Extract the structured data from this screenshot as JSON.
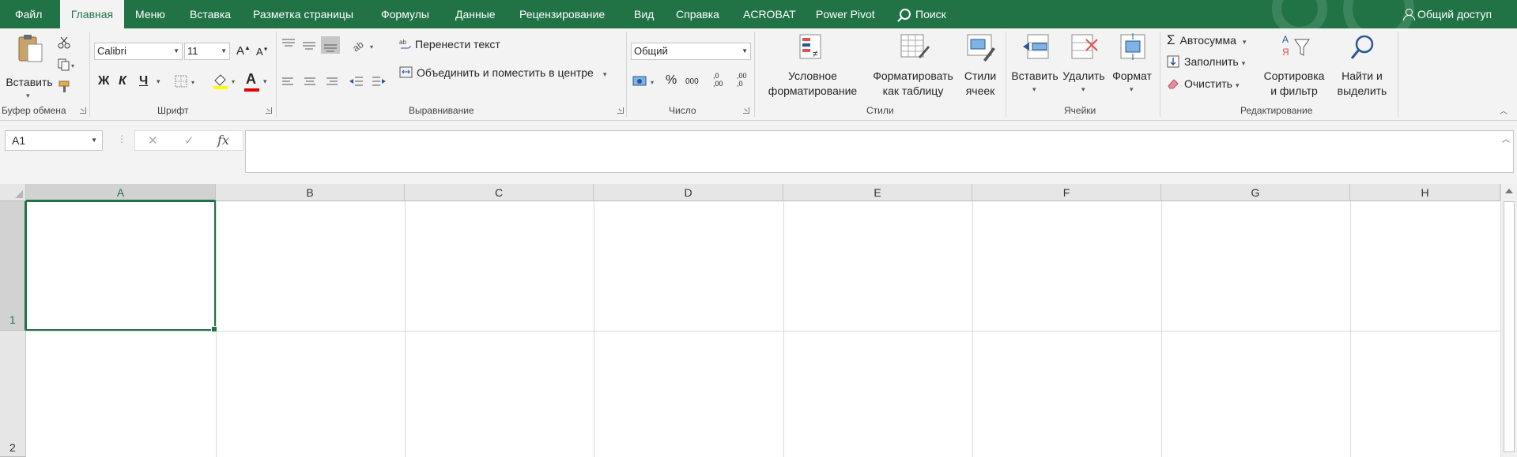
{
  "menu": {
    "tabs": [
      "Файл",
      "Главная",
      "Меню",
      "Вставка",
      "Разметка страницы",
      "Формулы",
      "Данные",
      "Рецензирование",
      "Вид",
      "Справка",
      "ACROBAT",
      "Power Pivot"
    ],
    "active_tab": "Главная",
    "search": "Поиск",
    "share": "Общий доступ"
  },
  "ribbon": {
    "clipboard": {
      "paste": "Вставить",
      "label": "Буфер обмена"
    },
    "font": {
      "name": "Calibri",
      "size": "11",
      "bold": "Ж",
      "italic": "К",
      "underline": "Ч",
      "grow": "A",
      "shrink": "A",
      "font_color": "A",
      "label": "Шрифт"
    },
    "alignment": {
      "wrap": "Перенести текст",
      "merge": "Объединить и поместить в центре",
      "label": "Выравнивание"
    },
    "number": {
      "format": "Общий",
      "percent": "%",
      "thousands": "000",
      "inc_dec": ",0\n,00",
      "dec_dec": ",00\n,0",
      "label": "Число"
    },
    "styles": {
      "conditional": "Условное\nформатирование",
      "as_table": "Форматировать\nкак таблицу",
      "cell_styles": "Стили\nячеек",
      "label": "Стили"
    },
    "cells": {
      "insert": "Вставить",
      "delete": "Удалить",
      "format": "Формат",
      "label": "Ячейки"
    },
    "editing": {
      "autosum": "Автосумма",
      "fill": "Заполнить",
      "clear": "Очистить",
      "sort": "Сортировка\nи фильтр",
      "find": "Найти и\nвыделить",
      "label": "Редактирование"
    }
  },
  "formula_bar": {
    "name_box": "A1",
    "fx": "fx",
    "cancel": "✕",
    "enter": "✓",
    "content": ""
  },
  "grid": {
    "columns": [
      "A",
      "B",
      "C",
      "D",
      "E",
      "F",
      "G",
      "H"
    ],
    "rows": [
      "1",
      "2"
    ],
    "active_cell": "A1"
  },
  "colors": {
    "brand": "#217346",
    "ribbon_bg": "#f3f3f3",
    "header_bg": "#e6e6e6"
  }
}
